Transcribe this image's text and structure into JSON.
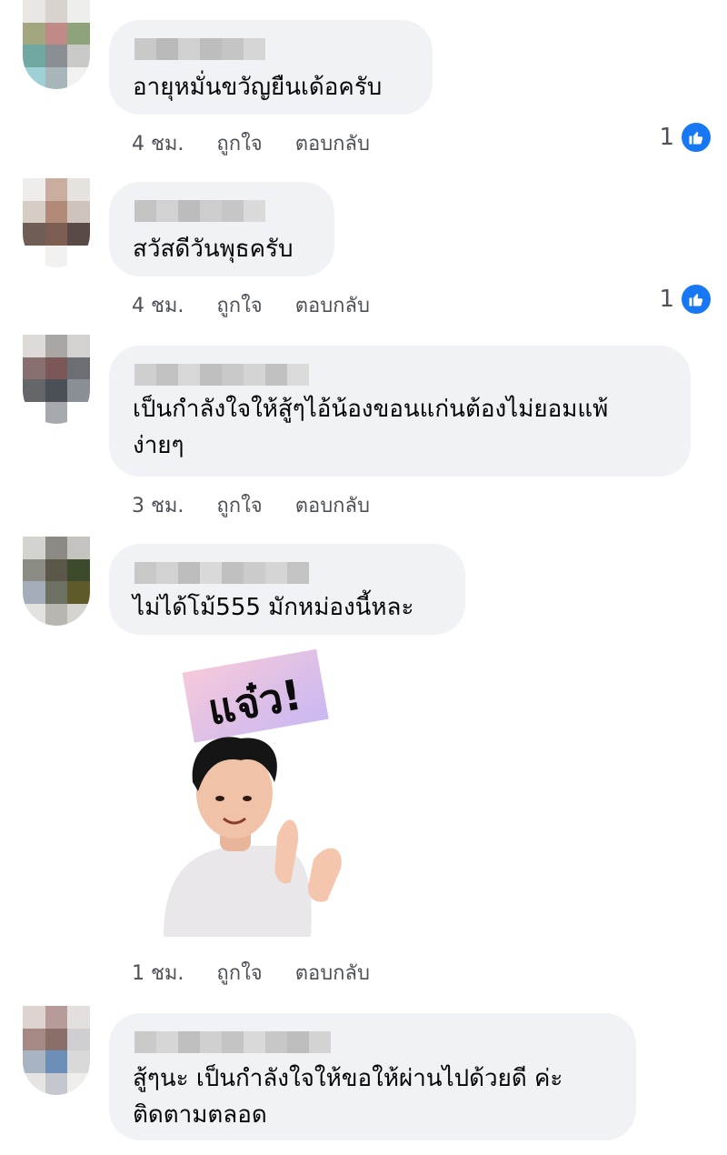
{
  "comments": [
    {
      "text_lines": [
        "อายุหมั่นขวัญยืนเด้อครับ"
      ],
      "time": "4 ชม.",
      "like_label": "ถูกใจ",
      "reply_label": "ตอบกลับ",
      "like_count": "1"
    },
    {
      "text_lines": [
        "สวัสดีวันพุธครับ"
      ],
      "time": "4 ชม.",
      "like_label": "ถูกใจ",
      "reply_label": "ตอบกลับ",
      "like_count": "1"
    },
    {
      "text_lines": [
        "เป็นกำลังใจให้สู้ๆไอ้น้องขอนแก่นต้องไม่ยอมแพ้",
        "ง่ายๆ"
      ],
      "time": "3 ชม.",
      "like_label": "ถูกใจ",
      "reply_label": "ตอบกลับ"
    },
    {
      "text_lines": [
        "ไม่ได้โม้555 มักหม่องนี้หละ"
      ],
      "time": "1 ชม.",
      "like_label": "ถูกใจ",
      "reply_label": "ตอบกลับ",
      "sticker_text": "แจ๋ว!"
    },
    {
      "text_lines": [
        "สู้ๆนะ เป็นกำลังใจให้ขอให้ผ่านไปด้วยดี ค่ะ",
        "ติดตามตลอด"
      ]
    }
  ],
  "icons": {
    "like": "thumbs-up-icon"
  },
  "colors": {
    "accent": "#1877f2",
    "bubble": "#f0f2f5",
    "meta_text": "#4e5158"
  }
}
